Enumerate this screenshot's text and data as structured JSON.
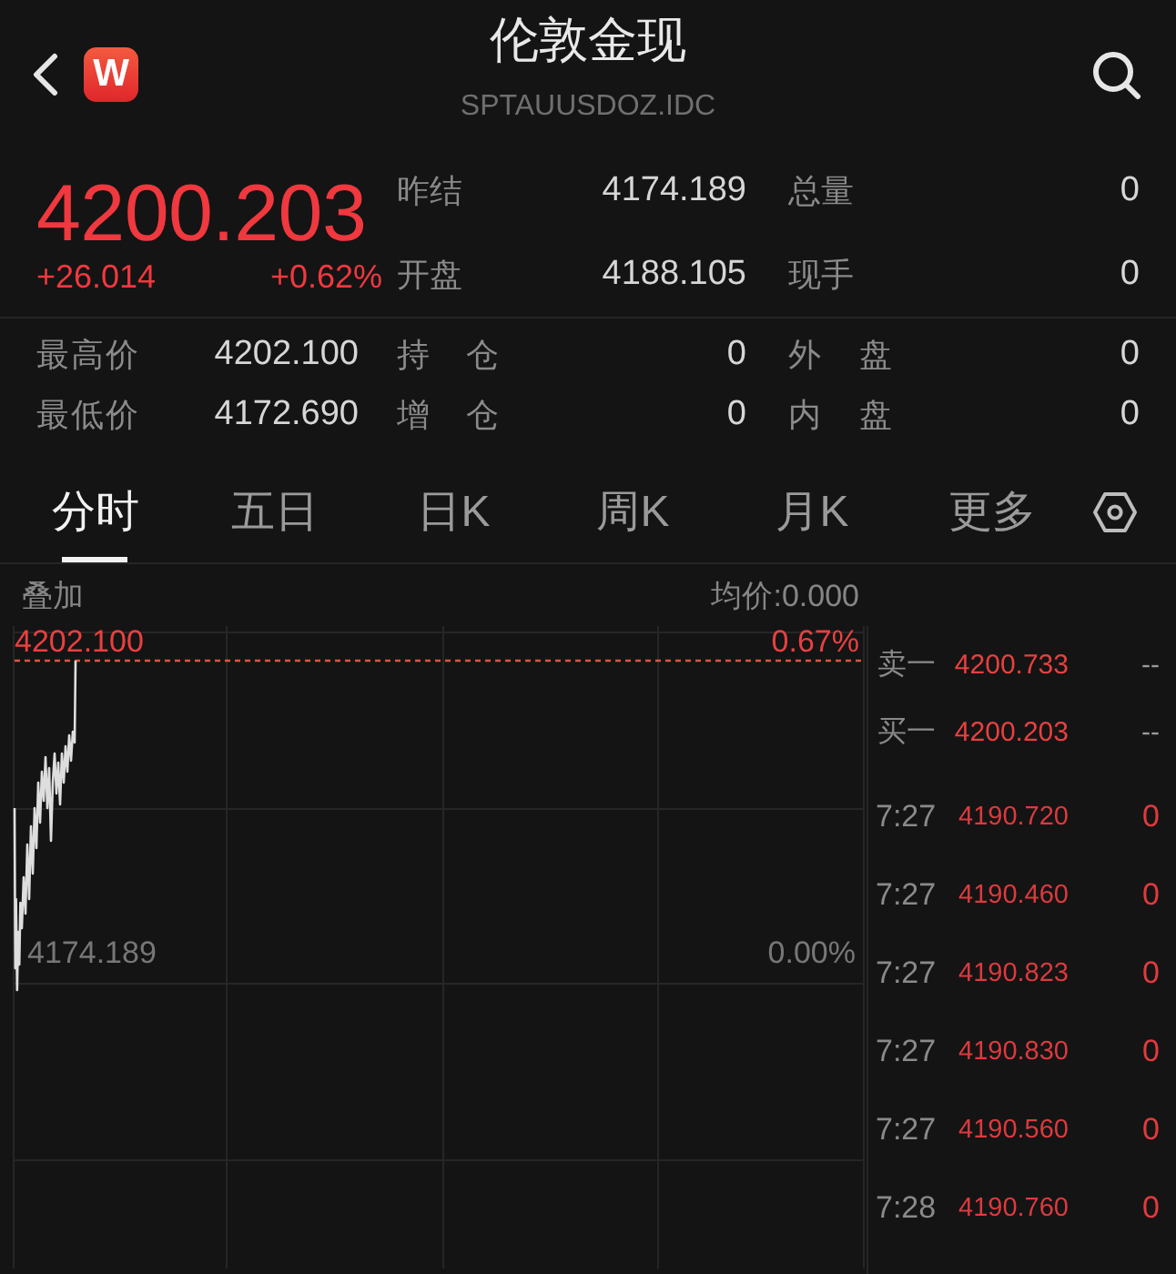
{
  "header": {
    "title": "伦敦金现",
    "subtitle": "SPTAUUSDOZ.IDC",
    "logo_text": "W"
  },
  "quote": {
    "price": "4200.203",
    "change": "+26.014",
    "change_percent": "+0.62%",
    "rising": true,
    "stats": [
      {
        "label": "昨结",
        "value": "4174.189"
      },
      {
        "label": "总量",
        "value": "0"
      },
      {
        "label": "开盘",
        "value": "4188.105"
      },
      {
        "label": "现手",
        "value": "0"
      }
    ]
  },
  "details": [
    {
      "label": "最高价",
      "value": "4202.100"
    },
    {
      "label": "持 仓",
      "value": "0"
    },
    {
      "label": "外 盘",
      "value": "0"
    },
    {
      "label": "最低价",
      "value": "4172.690"
    },
    {
      "label": "增 仓",
      "value": "0"
    },
    {
      "label": "内 盘",
      "value": "0"
    }
  ],
  "tabs": [
    {
      "label": "分时",
      "selected": true
    },
    {
      "label": "五日",
      "selected": false
    },
    {
      "label": "日K",
      "selected": false
    },
    {
      "label": "周K",
      "selected": false
    },
    {
      "label": "月K",
      "selected": false
    },
    {
      "label": "更多",
      "selected": false
    }
  ],
  "chart": {
    "overlay_label": "叠加",
    "average_price": "均价:0.000",
    "high_price": "4202.100",
    "high_percent": "0.67%",
    "base_price": "4174.189",
    "base_percent": "0.00%"
  },
  "order_book": [
    {
      "label": "卖一",
      "price": "4200.733",
      "volume": "--"
    },
    {
      "label": "买一",
      "price": "4200.203",
      "volume": "--"
    }
  ],
  "trades": [
    {
      "time": "7:27",
      "price": "4190.720",
      "volume": "0"
    },
    {
      "time": "7:27",
      "price": "4190.460",
      "volume": "0"
    },
    {
      "time": "7:27",
      "price": "4190.823",
      "volume": "0"
    },
    {
      "time": "7:27",
      "price": "4190.830",
      "volume": "0"
    },
    {
      "time": "7:27",
      "price": "4190.560",
      "volume": "0"
    },
    {
      "time": "7:28",
      "price": "4190.760",
      "volume": "0"
    }
  ]
}
